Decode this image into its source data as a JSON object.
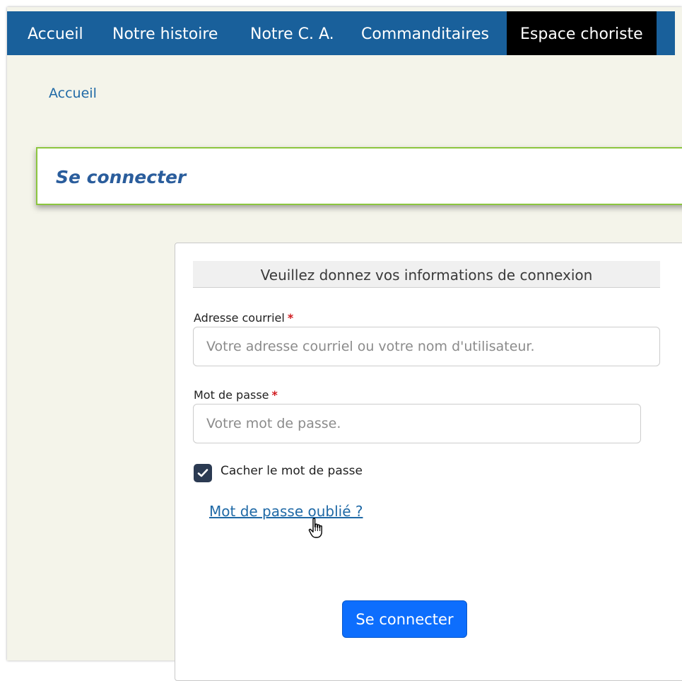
{
  "nav": {
    "items": [
      {
        "label": "Accueil"
      },
      {
        "label": "Notre histoire"
      },
      {
        "label": "Notre C. A."
      },
      {
        "label": "Commanditaires"
      },
      {
        "label": "Espace choriste",
        "active": true
      }
    ]
  },
  "breadcrumb": {
    "home": "Accueil"
  },
  "page": {
    "title": "Se connecter"
  },
  "form": {
    "legend": "Veuillez donnez vos informations de connexion",
    "email": {
      "label": "Adresse courriel",
      "required_mark": "*",
      "value": "",
      "placeholder": "Votre adresse courriel ou votre nom d'utilisateur."
    },
    "password": {
      "label": "Mot de passe",
      "required_mark": "*",
      "value": "",
      "placeholder": "Votre mot de passe."
    },
    "hide_password": {
      "label": "Cacher le mot de passe",
      "checked": true
    },
    "forgot_link": "Mot de passe oublié ?",
    "submit_label": "Se connecter"
  },
  "colors": {
    "nav_background": "#19609b",
    "nav_active_background": "#000000",
    "page_background": "#f4f4ea",
    "title_border": "#8cc63f",
    "title_text": "#2a5d9c",
    "link": "#1f69a6",
    "required": "#d0191e",
    "checkbox": "#2b3a52",
    "button": "#0d6efd"
  },
  "icons": {
    "checkbox_mark": "checkmark-icon",
    "mouse_cursor": "hand-pointer-cursor-icon"
  }
}
